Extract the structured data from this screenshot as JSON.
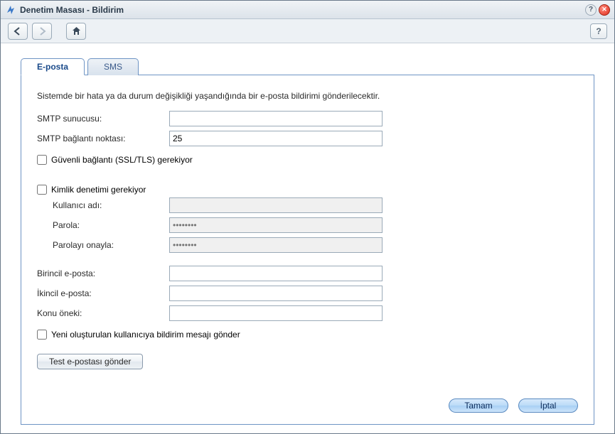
{
  "window": {
    "title": "Denetim Masası - Bildirim"
  },
  "tabs": {
    "eposta": "E-posta",
    "sms": "SMS"
  },
  "form": {
    "intro": "Sistemde bir hata ya da durum değişikliği yaşandığında bir e-posta bildirimi gönderilecektir.",
    "smtp_server_label": "SMTP sunucusu:",
    "smtp_server_value": "",
    "smtp_port_label": "SMTP bağlantı noktası:",
    "smtp_port_value": "25",
    "ssl_label": "Güvenli bağlantı (SSL/TLS) gerekiyor",
    "ssl_checked": false,
    "auth_label": "Kimlik denetimi gerekiyor",
    "auth_checked": false,
    "username_label": "Kullanıcı adı:",
    "username_value": "",
    "password_label": "Parola:",
    "password_value": "",
    "password_confirm_label": "Parolayı onayla:",
    "password_confirm_value": "",
    "primary_email_label": "Birincil e-posta:",
    "primary_email_value": "",
    "secondary_email_label": "İkincil e-posta:",
    "secondary_email_value": "",
    "subject_prefix_label": "Konu öneki:",
    "subject_prefix_value": "",
    "notify_new_user_label": "Yeni oluşturulan kullanıcıya bildirim mesajı gönder",
    "notify_new_user_checked": false,
    "test_button": "Test e-postası gönder"
  },
  "footer": {
    "ok": "Tamam",
    "cancel": "İptal"
  }
}
